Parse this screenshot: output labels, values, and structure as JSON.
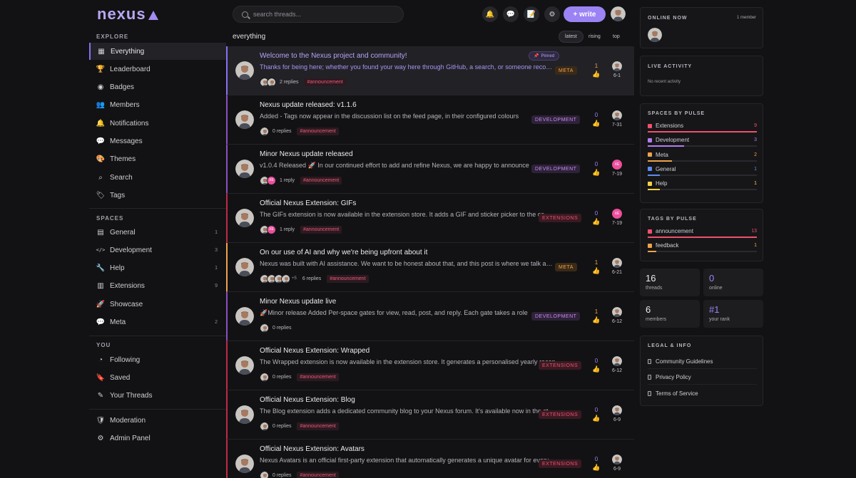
{
  "app": {
    "logo_text": "nexus"
  },
  "sidebar": {
    "explore_label": "EXPLORE",
    "explore": [
      {
        "label": "Everything",
        "icon": "grid-icon",
        "glyph": "▦",
        "active": true
      },
      {
        "label": "Leaderboard",
        "icon": "trophy-icon",
        "glyph": "🏆"
      },
      {
        "label": "Badges",
        "icon": "badge-icon",
        "glyph": "◉"
      },
      {
        "label": "Members",
        "icon": "users-icon",
        "glyph": "👥"
      },
      {
        "label": "Notifications",
        "icon": "bell-icon",
        "glyph": "🔔"
      },
      {
        "label": "Messages",
        "icon": "chat-icon",
        "glyph": "💬"
      },
      {
        "label": "Themes",
        "icon": "palette-icon",
        "glyph": "🎨"
      },
      {
        "label": "Search",
        "icon": "search-icon",
        "glyph": "⌕"
      },
      {
        "label": "Tags",
        "icon": "tag-icon",
        "glyph": "🏷"
      }
    ],
    "spaces_label": "SPACES",
    "spaces": [
      {
        "label": "General",
        "icon": "book-icon",
        "glyph": "▤",
        "count": "1"
      },
      {
        "label": "Development",
        "icon": "code-icon",
        "glyph": "</>",
        "count": "3"
      },
      {
        "label": "Help",
        "icon": "wrench-icon",
        "glyph": "🔧",
        "count": "1"
      },
      {
        "label": "Extensions",
        "icon": "map-icon",
        "glyph": "▥",
        "count": "9"
      },
      {
        "label": "Showcase",
        "icon": "rocket-icon",
        "glyph": "🚀",
        "count": ""
      },
      {
        "label": "Meta",
        "icon": "chat-bubble-icon",
        "glyph": "💬",
        "count": "2"
      }
    ],
    "you_label": "YOU",
    "you": [
      {
        "label": "Following",
        "icon": "rss-icon",
        "glyph": "◔"
      },
      {
        "label": "Saved",
        "icon": "bookmark-icon",
        "glyph": "🔖"
      },
      {
        "label": "Your Threads",
        "icon": "edit-icon",
        "glyph": "✎"
      }
    ],
    "admin": [
      {
        "label": "Moderation",
        "icon": "shield-icon",
        "glyph": "🛡"
      },
      {
        "label": "Admin Panel",
        "icon": "gear-icon",
        "glyph": "⚙"
      }
    ]
  },
  "topbar": {
    "search_placeholder": "search threads...",
    "write_label": "+ write",
    "buttons": [
      {
        "name": "notifications-button",
        "icon": "bell-icon",
        "glyph": "🔔"
      },
      {
        "name": "messages-button",
        "icon": "chat-icon",
        "glyph": "💬"
      },
      {
        "name": "drafts-button",
        "icon": "edit-note-icon",
        "glyph": "📝"
      },
      {
        "name": "settings-button",
        "icon": "gear-icon",
        "glyph": "⚙"
      }
    ]
  },
  "feed": {
    "title": "everything",
    "sort": [
      "latest",
      "rising",
      "top"
    ],
    "threads": [
      {
        "title": "Welcome to the Nexus project and community!",
        "excerpt": "Thanks for being here; whether you found your way here through GitHub, a search, or someone recommending it to you",
        "tag": "META",
        "replies": "2 replies",
        "hashtag": "#announcement",
        "votes": "1",
        "date": "6-1",
        "pinned": true,
        "pinned_label": "Pinned",
        "participants": 2,
        "more": "",
        "last_initials": ""
      },
      {
        "title": "Nexus update released: v1.1.6",
        "excerpt": "Added - Tags now appear in the discussion list on the feed page, in their configured colours",
        "tag": "DEVELOPMENT",
        "replies": "0 replies",
        "hashtag": "#announcement",
        "votes": "0",
        "date": "7-31",
        "pinned": false,
        "participants": 1,
        "more": "",
        "last_initials": ""
      },
      {
        "title": "Minor Nexus update released",
        "excerpt": "v1.0.4 Released 🚀 In our continued effort to add and refine Nexus, we are happy to announce",
        "tag": "DEVELOPMENT",
        "replies": "1 reply",
        "hashtag": "#announcement",
        "votes": "0",
        "date": "7-19",
        "pinned": false,
        "participants": 2,
        "more": "",
        "last_initials": "XE"
      },
      {
        "title": "Official Nexus Extension: GIFs",
        "excerpt": "The GIFs extension is now available in the extension store. It adds a GIF and sticker picker to the composer",
        "tag": "EXTENSIONS",
        "replies": "1 reply",
        "hashtag": "#announcement",
        "votes": "0",
        "date": "7-19",
        "pinned": false,
        "participants": 2,
        "more": "",
        "last_initials": "XE"
      },
      {
        "title": "On our use of AI and why we're being upfront about it",
        "excerpt": "Nexus was built with AI assistance. We want to be honest about that, and this post is where we talk about it",
        "tag": "META",
        "replies": "6 replies",
        "hashtag": "#announcement",
        "votes": "1",
        "date": "6-21",
        "pinned": false,
        "participants": 4,
        "more": "+5",
        "last_initials": ""
      },
      {
        "title": "Minor Nexus update live",
        "excerpt": "🚀Minor release Added Per-space gates for view, read, post, and reply. Each gate takes a role",
        "tag": "DEVELOPMENT",
        "replies": "0 replies",
        "hashtag": "",
        "votes": "1",
        "date": "6-12",
        "pinned": false,
        "participants": 1,
        "more": "",
        "last_initials": ""
      },
      {
        "title": "Official Nexus Extension: Wrapped",
        "excerpt": "The Wrapped extension is now available in the extension store. It generates a personalised yearly recap",
        "tag": "EXTENSIONS",
        "replies": "0 replies",
        "hashtag": "#announcement",
        "votes": "0",
        "date": "6-12",
        "pinned": false,
        "participants": 1,
        "more": "",
        "last_initials": ""
      },
      {
        "title": "Official Nexus Extension: Blog",
        "excerpt": "The Blog extension adds a dedicated community blog to your Nexus forum. It's available now in the store",
        "tag": "EXTENSIONS",
        "replies": "0 replies",
        "hashtag": "#announcement",
        "votes": "0",
        "date": "6-9",
        "pinned": false,
        "participants": 1,
        "more": "",
        "last_initials": ""
      },
      {
        "title": "Official Nexus Extension: Avatars",
        "excerpt": "Nexus Avatars is an official first-party extension that automatically generates a unique avatar for every member",
        "tag": "EXTENSIONS",
        "replies": "0 replies",
        "hashtag": "#announcement",
        "votes": "0",
        "date": "6-9",
        "pinned": false,
        "participants": 1,
        "more": "",
        "last_initials": ""
      }
    ]
  },
  "tag_colors": {
    "META": {
      "fg": "#f0a24a",
      "bg": "#3a2a18",
      "border": "#f0a24a"
    },
    "DEVELOPMENT": {
      "fg": "#c98bf0",
      "bg": "#2d2238",
      "border": "#8a4fc0"
    },
    "EXTENSIONS": {
      "fg": "#f0506e",
      "bg": "#3a1a22",
      "border": "#c02a48"
    }
  },
  "right": {
    "online_title": "ONLINE NOW",
    "online_count": "1 member",
    "activity_title": "LIVE ACTIVITY",
    "activity_empty": "No recent activity",
    "spaces_title": "SPACES BY PULSE",
    "spaces_pulse": [
      {
        "label": "Extensions",
        "count": 9,
        "color": "#f0506e"
      },
      {
        "label": "Development",
        "count": 3,
        "color": "#b57cf0"
      },
      {
        "label": "Meta",
        "count": 2,
        "color": "#f0a24a"
      },
      {
        "label": "General",
        "count": 1,
        "color": "#5c8cf0"
      },
      {
        "label": "Help",
        "count": 1,
        "color": "#f0d04a"
      }
    ],
    "tags_title": "TAGS BY PULSE",
    "tags_pulse": [
      {
        "label": "announcement",
        "count": 13,
        "color": "#f0506e"
      },
      {
        "label": "feedback",
        "count": 1,
        "color": "#f0a24a"
      }
    ],
    "stats": [
      {
        "value": "16",
        "label": "threads",
        "color": "#ececf0"
      },
      {
        "value": "0",
        "label": "online",
        "color": "#9b83f4"
      },
      {
        "value": "6",
        "label": "members",
        "color": "#ececf0"
      },
      {
        "value": "#1",
        "label": "your rank",
        "color": "#9b83f4"
      }
    ],
    "legal_title": "LEGAL & INFO",
    "legal": [
      "Community Guidelines",
      "Privacy Policy",
      "Terms of Service"
    ]
  }
}
